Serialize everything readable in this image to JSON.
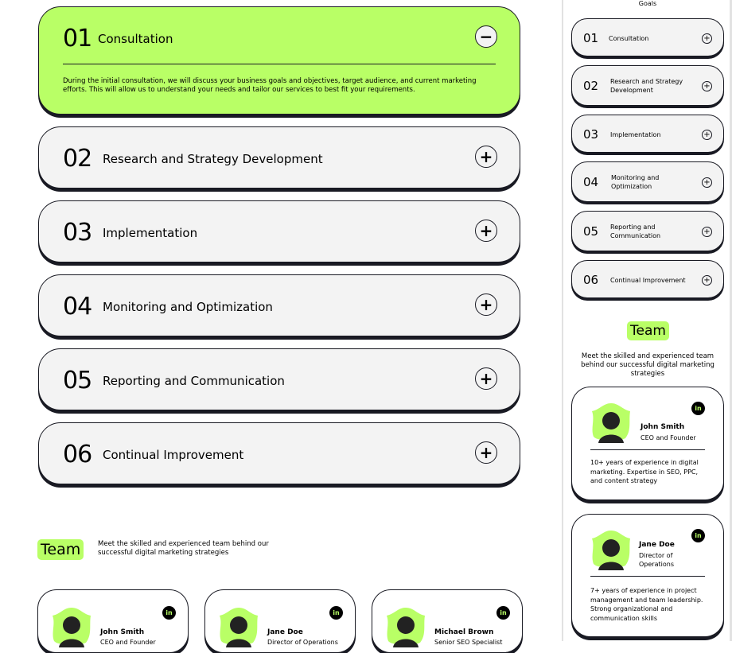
{
  "accordion": [
    {
      "num": "01",
      "title": "Consultation",
      "open": true,
      "toggle": "−",
      "body": "During the initial consultation, we will discuss your business goals and objectives, target audience, and current marketing efforts. This will allow us to understand your needs and tailor our services to best fit your requirements."
    },
    {
      "num": "02",
      "title": "Research and Strategy Development",
      "open": false,
      "toggle": "+"
    },
    {
      "num": "03",
      "title": "Implementation",
      "open": false,
      "toggle": "+"
    },
    {
      "num": "04",
      "title": "Monitoring and Optimization",
      "open": false,
      "toggle": "+"
    },
    {
      "num": "05",
      "title": "Reporting and Communication",
      "open": false,
      "toggle": "+"
    },
    {
      "num": "06",
      "title": "Continual Improvement",
      "open": false,
      "toggle": "+"
    }
  ],
  "team": {
    "heading": "Team",
    "description": "Meet the skilled and experienced team behind our successful digital marketing strategies",
    "members": [
      {
        "name": "John Smith",
        "role": "CEO and Founder",
        "bio": "10+ years of experience in digital marketing. Expertise in SEO, PPC, and content strategy"
      },
      {
        "name": "Jane Doe",
        "role": "Director of Operations",
        "bio": "7+ years of experience in project management and team leadership. Strong organizational and communication skills"
      },
      {
        "name": "Michael Brown",
        "role": "Senior SEO Specialist"
      }
    ],
    "linkedin_label": "in"
  },
  "mobile": {
    "top_text": "Goals",
    "accordion": [
      {
        "num": "01",
        "title": "Consultation",
        "toggle": "+"
      },
      {
        "num": "02",
        "title": "Research and Strategy Development",
        "toggle": "+"
      },
      {
        "num": "03",
        "title": "Implementation",
        "toggle": "+"
      },
      {
        "num": "04",
        "title": "Monitoring and Optimization",
        "toggle": "+"
      },
      {
        "num": "05",
        "title": "Reporting and Communication",
        "toggle": "+"
      },
      {
        "num": "06",
        "title": "Continual Improvement",
        "toggle": "+"
      }
    ]
  },
  "colors": {
    "accent": "#b9ff66",
    "dark": "#191a23",
    "card_bg": "#f3f3f3"
  }
}
